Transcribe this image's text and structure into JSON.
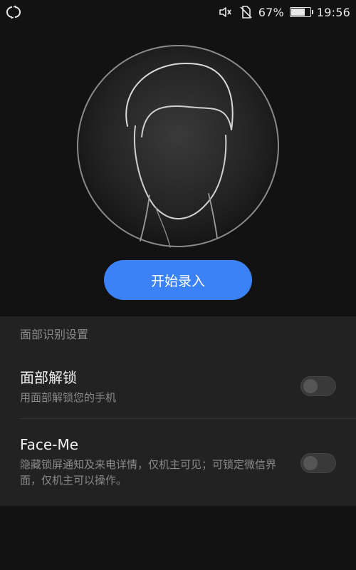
{
  "status_bar": {
    "left_icon": "sync-icon",
    "icons": [
      "vibrate-icon",
      "no-sim-icon"
    ],
    "battery_percent_text": "67%",
    "battery_level": 0.67,
    "time": "19:56"
  },
  "hero": {
    "illustration": "face-outline-illustration",
    "button_label": "开始录入"
  },
  "settings": {
    "section_title": "面部识别设置",
    "items": [
      {
        "title": "面部解锁",
        "subtitle": "用面部解锁您的手机",
        "enabled": false
      },
      {
        "title": "Face-Me",
        "subtitle": "隐藏锁屏通知及来电详情，仅机主可见；可锁定微信界面，仅机主可以操作。",
        "enabled": false
      }
    ]
  },
  "colors": {
    "background": "#121212",
    "panel": "#222222",
    "accent": "#3b82f6",
    "text_primary": "#f1f1f1",
    "text_secondary": "#8a8a8a"
  }
}
